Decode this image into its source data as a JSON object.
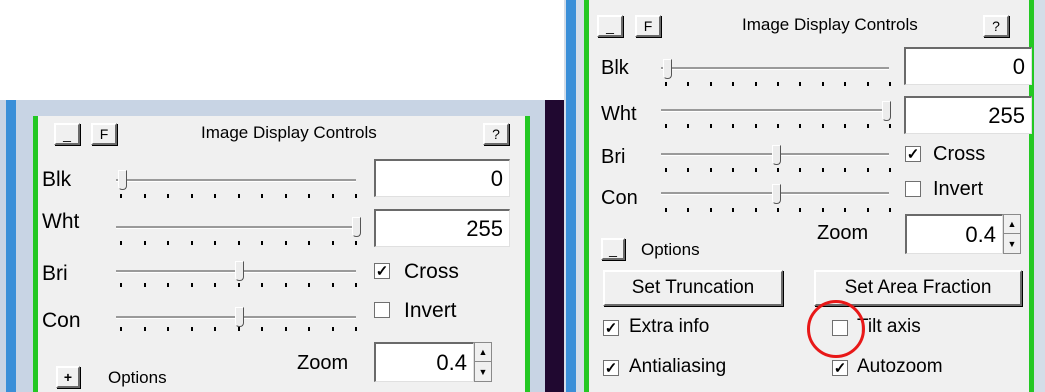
{
  "panel_title": "Image Display Controls",
  "buttons": {
    "minimize": "_",
    "f": "F",
    "help": "?",
    "expand": "+",
    "collapse": "_"
  },
  "sliders": {
    "blk_label": "Blk",
    "wht_label": "Wht",
    "bri_label": "Bri",
    "con_label": "Con"
  },
  "fields": {
    "blk_value": "0",
    "wht_value": "255",
    "zoom_label": "Zoom",
    "zoom_value": "0.4"
  },
  "checks": {
    "cross": "Cross",
    "invert": "Invert",
    "check_mark": "✓",
    "cross_checked": true,
    "invert_checked": false
  },
  "options_label": "Options",
  "options_panel": {
    "set_truncation": "Set Truncation",
    "set_area_fraction": "Set Area Fraction",
    "extra_info": "Extra info",
    "tilt_axis": "Tilt axis",
    "antialiasing": "Antialiasing",
    "autozoom": "Autozoom",
    "extra_info_checked": true,
    "tilt_axis_checked": false,
    "antialiasing_checked": true,
    "autozoom_checked": true
  },
  "slider_positions": {
    "blk": 0,
    "wht": 255,
    "bri": 0.5,
    "con": 0.5
  },
  "colors": {
    "accent_green": "#23c823",
    "highlight_red": "#e81818",
    "window_blue": "#3a8fd8"
  }
}
